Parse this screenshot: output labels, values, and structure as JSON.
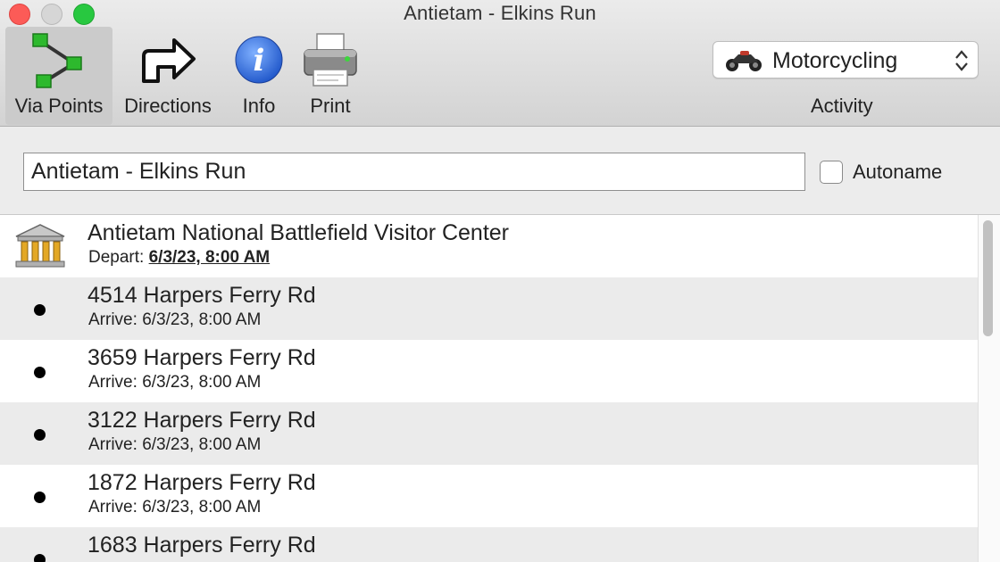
{
  "window": {
    "title": "Antietam - Elkins Run"
  },
  "toolbar": {
    "via_points_label": "Via Points",
    "directions_label": "Directions",
    "info_label": "Info",
    "print_label": "Print",
    "activity_value": "Motorcycling",
    "activity_label": "Activity"
  },
  "route": {
    "name": "Antietam - Elkins Run",
    "autoname_label": "Autoname",
    "autoname_checked": false
  },
  "via_points": [
    {
      "name": "Antietam National Battlefield Visitor Center",
      "kind": "Depart:",
      "time": "6/3/23, 8:00 AM",
      "icon": "visitor-center-icon"
    },
    {
      "name": "4514 Harpers Ferry Rd",
      "kind": "Arrive:",
      "time": "6/3/23, 8:00 AM",
      "icon": "via-point-dot-icon"
    },
    {
      "name": "3659 Harpers Ferry Rd",
      "kind": "Arrive:",
      "time": "6/3/23, 8:00 AM",
      "icon": "via-point-dot-icon"
    },
    {
      "name": "3122 Harpers Ferry Rd",
      "kind": "Arrive:",
      "time": "6/3/23, 8:00 AM",
      "icon": "via-point-dot-icon"
    },
    {
      "name": "1872 Harpers Ferry Rd",
      "kind": "Arrive:",
      "time": "6/3/23, 8:00 AM",
      "icon": "via-point-dot-icon"
    },
    {
      "name": "1683 Harpers Ferry Rd",
      "kind": "",
      "time": "",
      "icon": "via-point-dot-icon"
    }
  ],
  "colors": {
    "selected_tool": "#cbcbcb",
    "alt_row": "#ebebeb",
    "info_blue": "#2f6fd8",
    "via_green": "#2db92d"
  }
}
